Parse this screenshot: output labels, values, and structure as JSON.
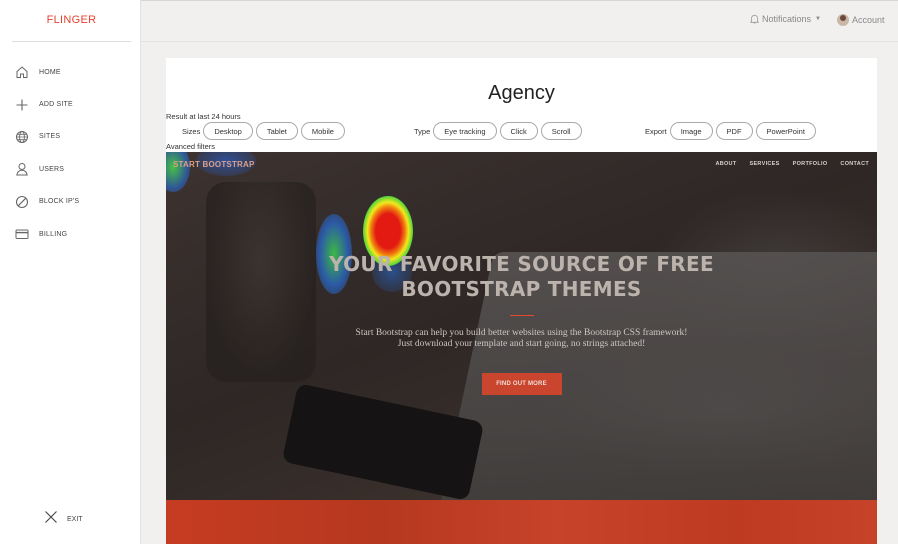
{
  "sidebar": {
    "brand": "FLINGER",
    "items": [
      {
        "label": "HOME",
        "icon": "home-icon"
      },
      {
        "label": "ADD SITE",
        "icon": "plus-icon"
      },
      {
        "label": "SITES",
        "icon": "globe-icon"
      },
      {
        "label": "USERS",
        "icon": "user-icon"
      },
      {
        "label": "BLOCK IP'S",
        "icon": "block-icon"
      },
      {
        "label": "BILLING",
        "icon": "credit-card-icon"
      }
    ],
    "exit_label": "EXIT"
  },
  "topbar": {
    "notifications": "Notifications",
    "account": "Account"
  },
  "card": {
    "title": "Agency",
    "result_text": "Result at last 24 hours",
    "advanced_filters": "Avanced filters",
    "sizes_label": "Sizes",
    "sizes": [
      "Desktop",
      "Tablet",
      "Mobile"
    ],
    "type_label": "Type",
    "types": [
      "Eye tracking",
      "Click",
      "Scroll"
    ],
    "export_label": "Export",
    "exports": [
      "Image",
      "PDF",
      "PowerPoint"
    ]
  },
  "preview": {
    "brand": "START BOOTSTRAP",
    "nav": [
      "ABOUT",
      "SERVICES",
      "PORTFOLIO",
      "CONTACT"
    ],
    "hero_line1": "YOUR FAVORITE SOURCE OF FREE",
    "hero_line2": "BOOTSTRAP THEMES",
    "sub_line1": "Start Bootstrap can help you build better websites using the Bootstrap CSS framework!",
    "sub_line2": "Just download your template and start going, no strings attached!",
    "cta": "FIND OUT MORE"
  },
  "colors": {
    "brand_red": "#e8422f",
    "cta_red": "#c9452d"
  }
}
